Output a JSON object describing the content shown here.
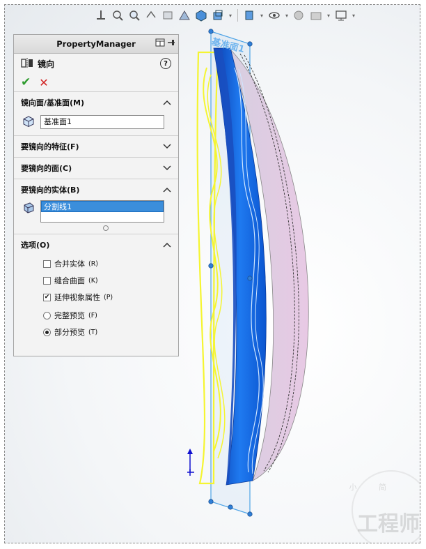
{
  "panel": {
    "header_title": "PropertyManager",
    "feature_title": "镜向",
    "help_symbol": "?",
    "ok_symbol": "✔",
    "cancel_symbol": "✕"
  },
  "sections": {
    "mirror_plane": {
      "title": "镜向面/基准面(M)",
      "value": "基准面1",
      "expanded": true
    },
    "features": {
      "title": "要镜向的特征(F)",
      "expanded": false
    },
    "faces": {
      "title": "要镜向的面(C)",
      "expanded": false
    },
    "bodies": {
      "title": "要镜向的实体(B)",
      "selected_item": "分割线1",
      "expanded": true
    },
    "options": {
      "title": "选项(O)",
      "expanded": true,
      "checkboxes": [
        {
          "label": "合并实体",
          "key": "(R)",
          "checked": false
        },
        {
          "label": "缝合曲面",
          "key": "(K)",
          "checked": false
        },
        {
          "label": "延伸视象属性",
          "key": "(P)",
          "checked": true
        }
      ],
      "radios": [
        {
          "label": "完整预览",
          "key": "(F)",
          "selected": false
        },
        {
          "label": "部分预览",
          "key": "(T)",
          "selected": true
        }
      ]
    }
  },
  "viewport": {
    "plane_label": "基准面1",
    "watermark_text": "工程师",
    "watermark_small": "小 简"
  },
  "colors": {
    "accent_blue": "#1f6fe0",
    "preview_yellow": "#ffff33",
    "ok_green": "#2e9b2e",
    "cancel_red": "#d12020"
  }
}
